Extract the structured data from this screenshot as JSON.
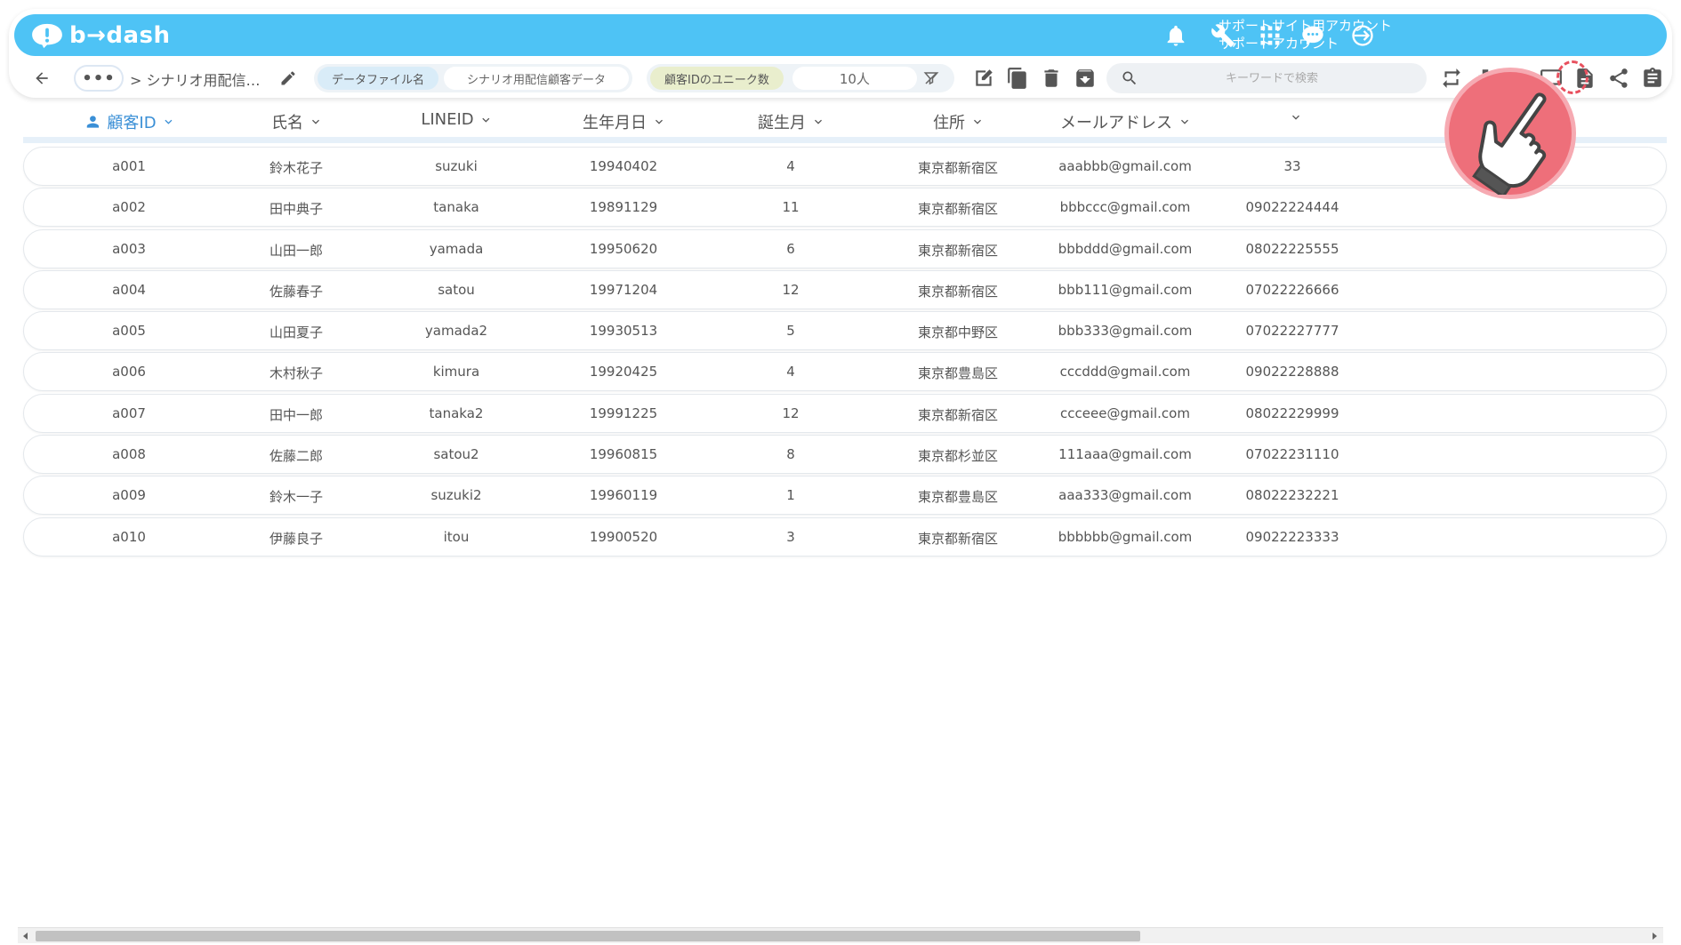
{
  "header": {
    "logo_text": "b→dash",
    "account_line1": "サポートサイト用アカウント",
    "account_line2": "サポートアカウント",
    "icons": [
      "bell-icon",
      "wrench-icon",
      "apps-grid-icon",
      "assistant-icon",
      "logout-icon"
    ]
  },
  "toolbar": {
    "back_icon": "back-arrow-icon",
    "more_label": "•••",
    "breadcrumb": "> シナリオ用配信…",
    "datafile_label": "データファイル名",
    "datafile_value": "シナリオ用配信顧客データ",
    "unique_label": "顧客IDのユニーク数",
    "unique_value": "10人",
    "search_placeholder": "キーワードで検索"
  },
  "table": {
    "columns": [
      {
        "label": "顧客ID",
        "active": true
      },
      {
        "label": "氏名"
      },
      {
        "label": "LINEID"
      },
      {
        "label": "生年月日"
      },
      {
        "label": "誕生月"
      },
      {
        "label": "住所"
      },
      {
        "label": "メールアドレス"
      },
      {
        "label": ""
      }
    ],
    "rows": [
      [
        "a001",
        "鈴木花子",
        "suzuki",
        "19940402",
        "4",
        "東京都新宿区",
        "aaabbb@gmail.com",
        "33"
      ],
      [
        "a002",
        "田中典子",
        "tanaka",
        "19891129",
        "11",
        "東京都新宿区",
        "bbbccc@gmail.com",
        "09022224444"
      ],
      [
        "a003",
        "山田一郎",
        "yamada",
        "19950620",
        "6",
        "東京都新宿区",
        "bbbddd@gmail.com",
        "08022225555"
      ],
      [
        "a004",
        "佐藤春子",
        "satou",
        "19971204",
        "12",
        "東京都新宿区",
        "bbb111@gmail.com",
        "07022226666"
      ],
      [
        "a005",
        "山田夏子",
        "yamada2",
        "19930513",
        "5",
        "東京都中野区",
        "bbb333@gmail.com",
        "07022227777"
      ],
      [
        "a006",
        "木村秋子",
        "kimura",
        "19920425",
        "4",
        "東京都豊島区",
        "cccddd@gmail.com",
        "09022228888"
      ],
      [
        "a007",
        "田中一郎",
        "tanaka2",
        "19991225",
        "12",
        "東京都新宿区",
        "ccceee@gmail.com",
        "08022229999"
      ],
      [
        "a008",
        "佐藤二郎",
        "satou2",
        "19960815",
        "8",
        "東京都杉並区",
        "111aaa@gmail.com",
        "07022231110"
      ],
      [
        "a009",
        "鈴木一子",
        "suzuki2",
        "19960119",
        "1",
        "東京都豊島区",
        "aaa333@gmail.com",
        "08022232221"
      ],
      [
        "a010",
        "伊藤良子",
        "itou",
        "19900520",
        "3",
        "東京都新宿区",
        "bbbbbb@gmail.com",
        "09022223333"
      ]
    ]
  },
  "colors": {
    "header_bg": "#4ec3f5",
    "active_column": "#3a8fd6",
    "pointer": "#ee6f7a"
  }
}
